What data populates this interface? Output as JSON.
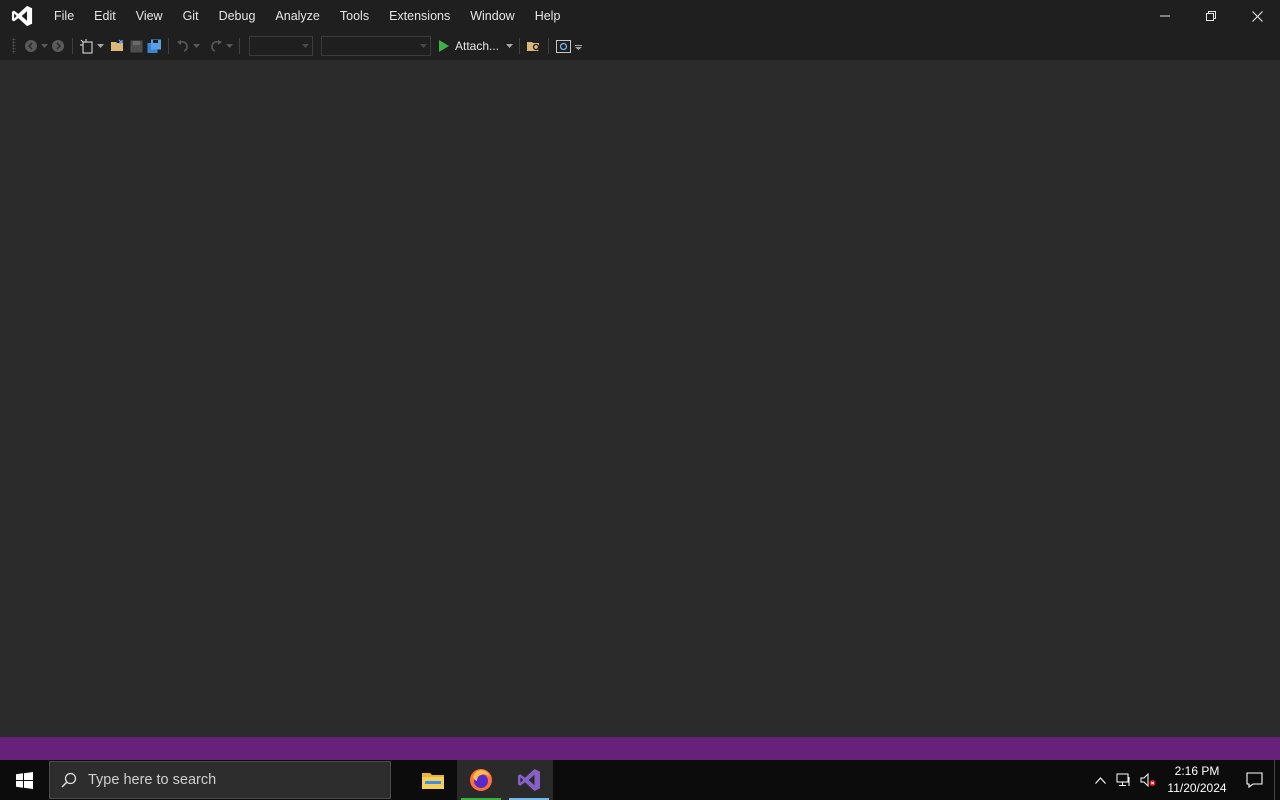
{
  "window": {
    "app_name": "Visual Studio",
    "menu": [
      "File",
      "Edit",
      "View",
      "Git",
      "Debug",
      "Analyze",
      "Tools",
      "Extensions",
      "Window",
      "Help"
    ]
  },
  "toolbar": {
    "attach_label": "Attach...",
    "solution_config_value": "",
    "solution_platform_value": ""
  },
  "statusbar": {
    "color": "#68217a"
  },
  "taskbar": {
    "search_placeholder": "Type here to search",
    "apps": [
      "file-explorer",
      "firefox",
      "visual-studio"
    ],
    "clock": {
      "time": "2:16 PM",
      "date": "11/20/2024"
    }
  },
  "colors": {
    "accent": "#68217a",
    "vs_purple": "#8661c5",
    "workspace_bg": "#2b2b2b",
    "chrome_bg": "#1f1f1f"
  }
}
